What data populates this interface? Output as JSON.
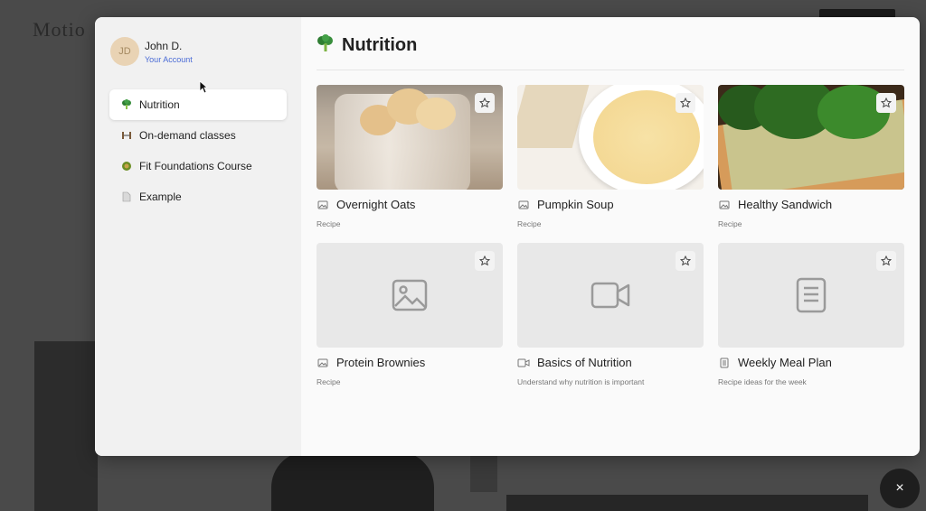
{
  "background": {
    "logo": "Motio"
  },
  "account": {
    "initials": "JD",
    "name": "John D.",
    "link": "Your Account"
  },
  "sidebar": {
    "items": [
      {
        "label": "Nutrition",
        "icon": "broccoli-icon",
        "active": true
      },
      {
        "label": "On-demand classes",
        "icon": "dumbbell-icon",
        "active": false
      },
      {
        "label": "Fit Foundations Course",
        "icon": "course-icon",
        "active": false
      },
      {
        "label": "Example",
        "icon": "document-icon",
        "active": false
      }
    ]
  },
  "main": {
    "title": "Nutrition",
    "cards": [
      {
        "title": "Overnight Oats",
        "subtitle": "Recipe",
        "type": "image-icon",
        "thumb": "oats"
      },
      {
        "title": "Pumpkin Soup",
        "subtitle": "Recipe",
        "type": "image-icon",
        "thumb": "soup"
      },
      {
        "title": "Healthy Sandwich",
        "subtitle": "Recipe",
        "type": "image-icon",
        "thumb": "sandwich"
      },
      {
        "title": "Protein Brownies",
        "subtitle": "Recipe",
        "type": "image-icon",
        "thumb": "placeholder-image"
      },
      {
        "title": "Basics of Nutrition",
        "subtitle": "Understand why nutrition is important",
        "type": "video-icon",
        "thumb": "placeholder-video"
      },
      {
        "title": "Weekly Meal Plan",
        "subtitle": "Recipe ideas for the week",
        "type": "document-icon",
        "thumb": "placeholder-document"
      }
    ]
  },
  "close": {
    "label": "×"
  },
  "colors": {
    "accent_link": "#4a6bd6",
    "avatar_bg": "#e9d3b4",
    "broccoli": "#2e7d32"
  }
}
